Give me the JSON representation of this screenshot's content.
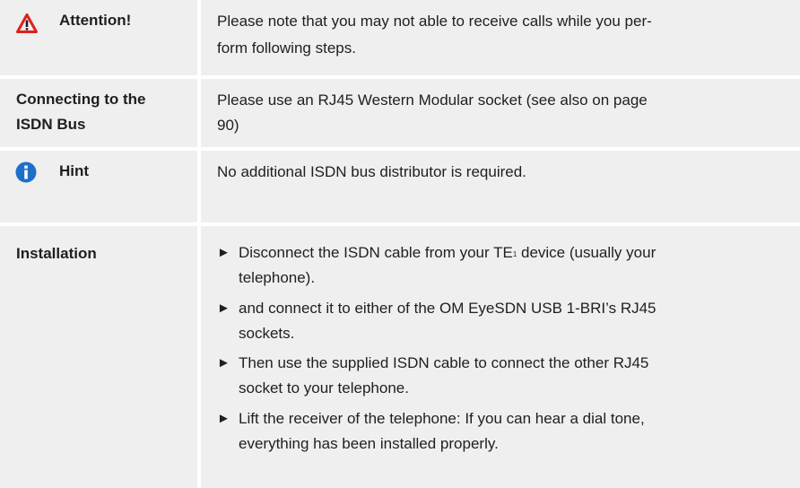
{
  "attention": {
    "label": "Attention!",
    "icon": "warning-icon",
    "icon_color": "#e0201b",
    "text_line1": "Please note that you may not able to receive calls while you per-",
    "text_line2": "form following steps."
  },
  "isdn_bus": {
    "label_line1": "Connecting to the",
    "label_line2": "ISDN Bus",
    "text_line1": "Please use an RJ45 Western Modular socket  (see also on page",
    "text_line2": "90)"
  },
  "hint": {
    "label": "Hint",
    "icon": "info-icon",
    "icon_color": "#1f6fc8",
    "text": "No additional ISDN bus distributor is required."
  },
  "installation": {
    "label": "Installation",
    "bullet": "►",
    "steps": [
      {
        "line1_pre": "Disconnect the ISDN cable from your TE",
        "footnote": "1",
        "line1_post": " device (usually your",
        "line2": "telephone)."
      },
      {
        "line1": "and connect it to either of the OM EyeSDN USB 1-BRI’s RJ45",
        "line2": "sockets."
      },
      {
        "line1": "Then use the supplied ISDN cable to connect the other RJ45",
        "line2": "socket to your telephone."
      },
      {
        "line1": "Lift the receiver of the telephone: If you can hear a dial tone,",
        "line2": "everything has been installed properly."
      }
    ]
  }
}
